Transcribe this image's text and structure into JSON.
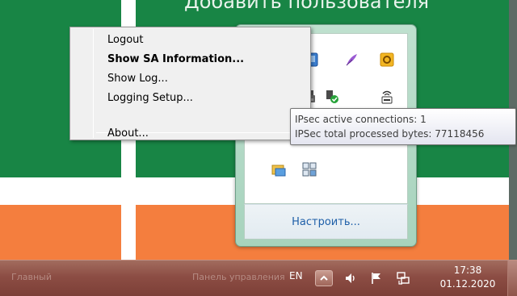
{
  "background": {
    "title": "Добавить пользователя",
    "taskbar_ghost_left": "Главный",
    "taskbar_ghost_mid": "Панель управления"
  },
  "context_menu": {
    "items": [
      "Logout",
      "Show SA Information...",
      "Show Log...",
      "Logging Setup...",
      "About..."
    ],
    "bold_item": "Show SA Information..."
  },
  "tooltip": {
    "line1": "IPsec active connections: 1",
    "line2": "IPSec total processed bytes: 77118456"
  },
  "tray_overflow": {
    "customize_link": "Настроить..."
  },
  "taskbar": {
    "language": "EN",
    "time": "17:38",
    "date": "01.12.2020"
  },
  "icons": {
    "tray_overflow": [
      "blue-app-icon",
      "feather-icon",
      "outlook-icon",
      "usb-device-icon",
      "security-shield-icon",
      "network-printer-icon",
      "network-folder-icon",
      "vpn-client-icon"
    ],
    "taskbar": [
      "chevron-up-icon",
      "volume-icon",
      "action-center-flag-icon",
      "network-icon"
    ]
  },
  "colors": {
    "background_green": "#188545",
    "background_orange": "#f47e3e",
    "taskbar": "#8c4d44",
    "link_blue": "#1e5fa8"
  }
}
